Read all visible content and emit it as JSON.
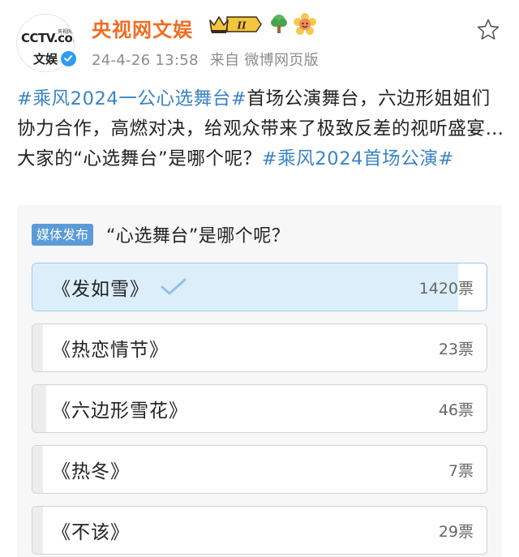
{
  "account": {
    "name": "央视网文娱",
    "avatar_logo": "CCTV.com",
    "avatar_logo_sub": "央视网",
    "avatar_label": "文娱",
    "verified_icon": "verified-badge-icon",
    "badges": [
      "crown-level-badge-icon",
      "tree-badge-icon",
      "flower-badge-icon"
    ],
    "badge_level": "II"
  },
  "meta": {
    "timestamp": "24-4-26 13:58",
    "source": "来自 微博网页版"
  },
  "post": {
    "topic1": "#乘风2024一公心选舞台#",
    "body": "首场公演舞台，六边形姐姐们协力合作，高燃对决，给观众带来了极致反差的视听盛宴…大家的“心选舞台”是哪个呢？",
    "topic2": "#乘风2024首场公演#"
  },
  "poll": {
    "tag": "媒体发布",
    "question": "“心选舞台”是哪个呢？",
    "options": [
      {
        "label": "《发如雪》",
        "votes": "1420票",
        "share": 0.937,
        "selected": true
      },
      {
        "label": "《热恋情节》",
        "votes": "23票",
        "share": 0.015,
        "selected": false
      },
      {
        "label": "《六边形雪花》",
        "votes": "46票",
        "share": 0.03,
        "selected": false
      },
      {
        "label": "《热冬》",
        "votes": "7票",
        "share": 0.005,
        "selected": false
      },
      {
        "label": "《不该》",
        "votes": "29票",
        "share": 0.019,
        "selected": false
      }
    ]
  },
  "colors": {
    "name": "#f26b21",
    "topic": "#3a83c7",
    "tag_bg": "#5b9bd8",
    "selected_fill": "#ddeefb",
    "selected_border": "#9cc9ea",
    "check": "#8fc1e6"
  }
}
